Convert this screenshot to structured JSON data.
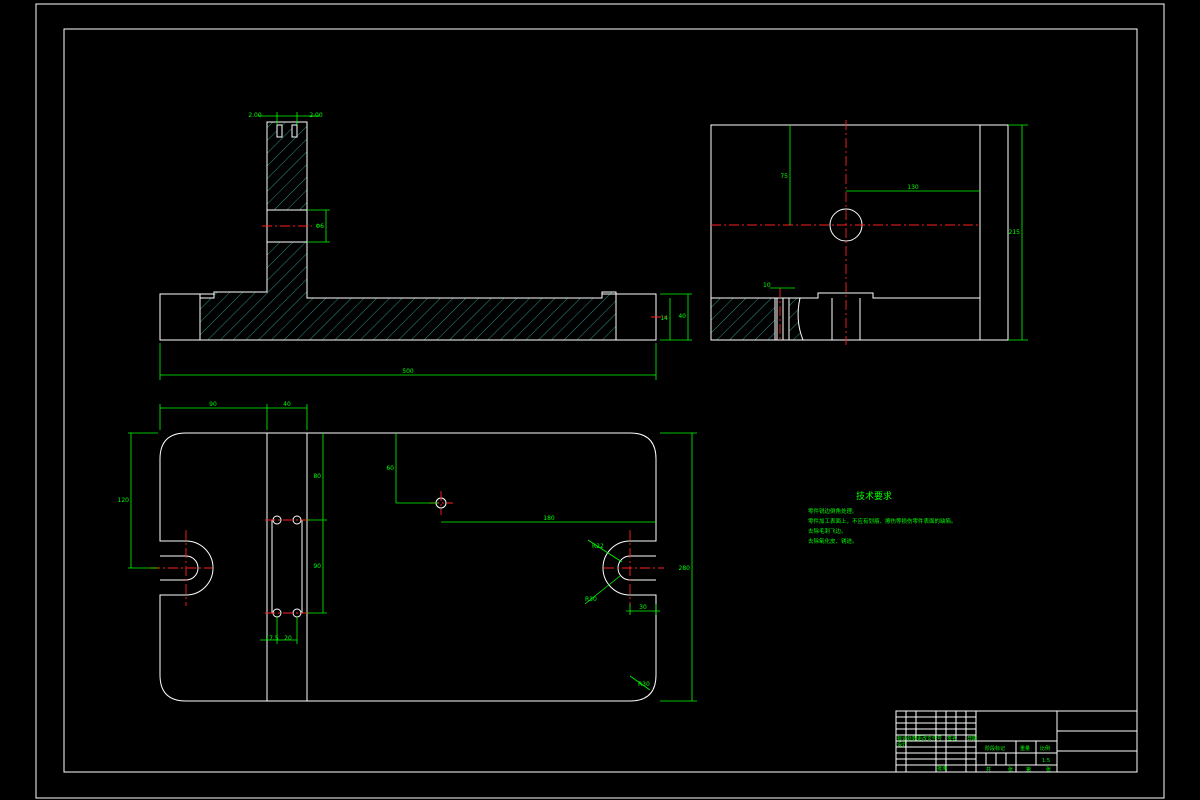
{
  "dimensions": {
    "slot_left": "2.00",
    "slot_right": "2.00",
    "hole_vertical": "Φ6",
    "total_length": "500",
    "base_height": "40",
    "base_step": "14",
    "side_top_offset": "75",
    "side_center_right": "130",
    "side_height": "215",
    "side_small": "10",
    "plan_left_width": "90",
    "plan_rib_width": "40",
    "plan_u_height": "120",
    "plan_hole_top": "60",
    "plan_hole_right": "180",
    "plan_rib_upper": "80",
    "plan_rib_lower": "90",
    "plan_hole_pitch": "17.5",
    "plan_hole_pitch2": "20",
    "plan_total_height": "280",
    "plan_u_radius1": "R22",
    "plan_u_radius2": "R30",
    "plan_u_offset": "30",
    "plan_corner_radius": "R30"
  },
  "notes": {
    "title": "技术要求",
    "items": [
      "零件锐边倒角处理。",
      "零件加工表面上，不应有划痕、擦伤等损伤零件表面的缺陷。",
      "去除毛刺飞边。",
      "去除氧化皮、锈迹。"
    ]
  },
  "title_block": {
    "row_labels": [
      "标记",
      "处数",
      "分区",
      "更改文件号",
      "签名",
      "日期"
    ],
    "design": "设计",
    "standardize": "标准化",
    "approve": "批准",
    "stage_label": "阶段标记",
    "weight_label": "重量",
    "scale_label": "比例",
    "scale_value": "1:5",
    "sheet_total": "共",
    "sheet_no": "第",
    "sheet_unit": "张"
  }
}
